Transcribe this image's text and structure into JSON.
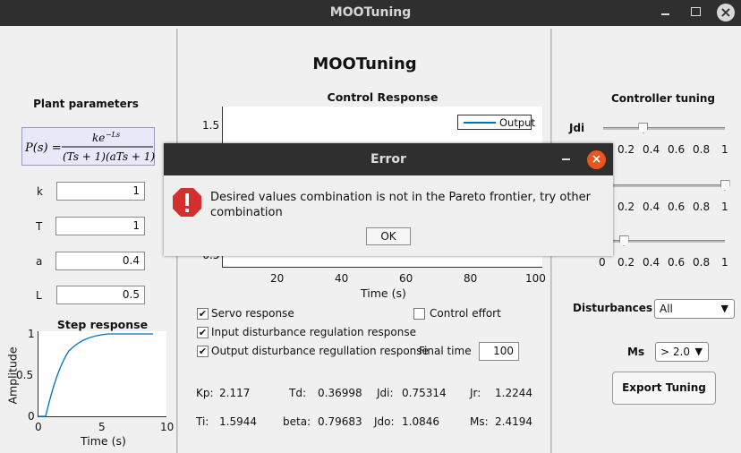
{
  "window": {
    "title": "MOOTuning"
  },
  "app_title": "MOOTuning",
  "plant": {
    "heading": "Plant parameters",
    "params": [
      {
        "label": "k",
        "value": "1"
      },
      {
        "label": "T",
        "value": "1"
      },
      {
        "label": "a",
        "value": "0.4"
      },
      {
        "label": "L",
        "value": "0.5"
      }
    ]
  },
  "step": {
    "title": "Step response",
    "ylabel": "Amplitude",
    "xlabel": "Time (s)",
    "yticks": [
      "0",
      "0.5",
      "1"
    ],
    "xticks": [
      "0",
      "5",
      "10"
    ]
  },
  "control_response": {
    "title": "Control Response",
    "legend": "Output",
    "xlabel": "Time (s)",
    "xticks": [
      "20",
      "40",
      "60",
      "80",
      "100"
    ],
    "ytick_top": "1.5",
    "ytick_bottom": "-0.5"
  },
  "options": {
    "servo": {
      "label": "Servo response",
      "checked": true
    },
    "control_effort": {
      "label": "Control effort",
      "checked": false
    },
    "input_dist": {
      "label": "Input disturbance regulation response",
      "checked": true
    },
    "output_dist": {
      "label": "Output disturbance regullation response",
      "checked": true
    },
    "final_time_label": "Final time",
    "final_time": "100"
  },
  "results": [
    [
      {
        "k": "Kp:",
        "v": "2.117"
      },
      {
        "k": "Td:",
        "v": "0.36998"
      },
      {
        "k": "Jdi:",
        "v": "0.75314"
      },
      {
        "k": "Jr:",
        "v": "1.2244"
      }
    ],
    [
      {
        "k": "Ti:",
        "v": "1.5944"
      },
      {
        "k": "beta:",
        "v": "0.79683"
      },
      {
        "k": "Jdo:",
        "v": "1.0846"
      },
      {
        "k": "Ms:",
        "v": "2.4194"
      }
    ]
  ],
  "tuning": {
    "heading": "Controller tuning",
    "slider_labels": [
      "Jdi"
    ],
    "ticks": [
      "0",
      "0.2",
      "0.4",
      "0.6",
      "0.8",
      "1"
    ],
    "slider_values": [
      0.33,
      1.0,
      0.17
    ],
    "disturbances_label": "Disturbances",
    "disturbances_value": "All",
    "ms_label": "Ms",
    "ms_value": "> 2.0",
    "export_label": "Export Tuning"
  },
  "dialog": {
    "title": "Error",
    "message": "Desired values combination is not in the Pareto frontier, try other combination",
    "ok": "OK",
    "icon": "error-icon"
  },
  "colors": {
    "accent": "#e95420",
    "line": "#0072bd",
    "error": "#d32f2f"
  }
}
